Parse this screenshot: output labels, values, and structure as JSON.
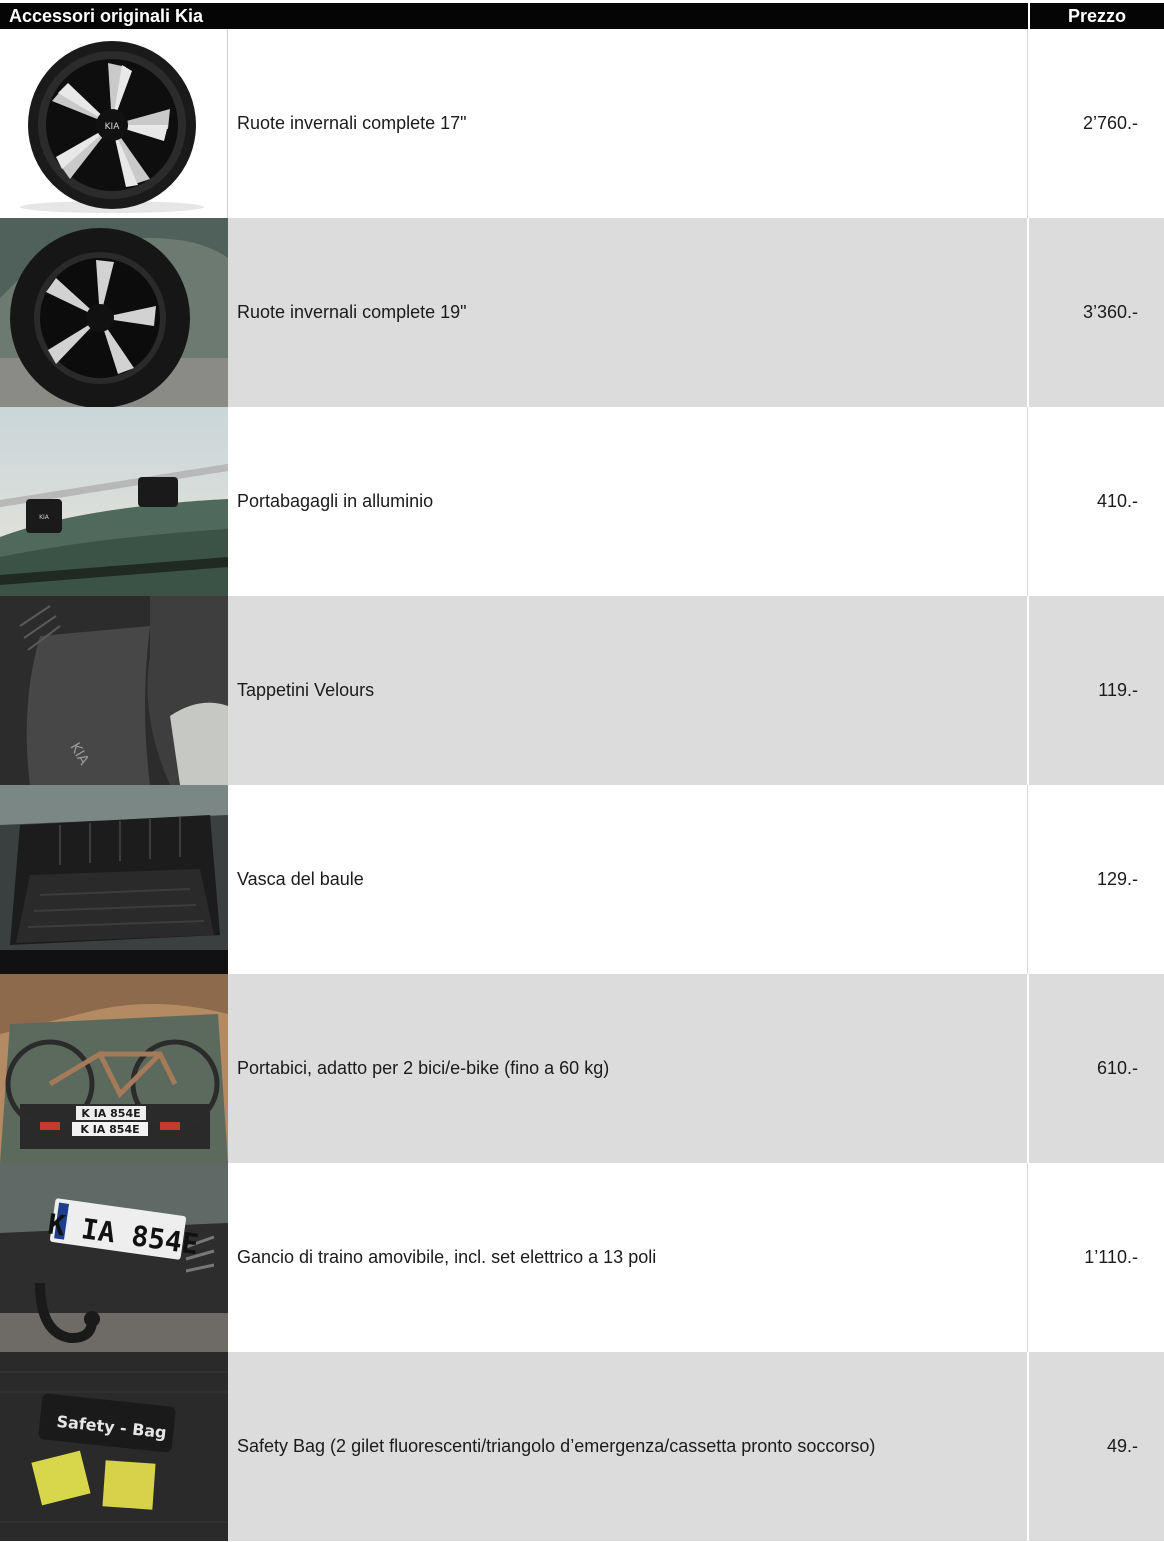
{
  "header": {
    "title": "Accessori originali Kia",
    "price": "Prezzo"
  },
  "rows": [
    {
      "desc": "Ruote invernali complete 17\"",
      "price": "2’760.-",
      "image": "alloy-wheel-17"
    },
    {
      "desc": "Ruote invernali complete 19\"",
      "price": "3’360.-",
      "image": "wheel-on-car-19"
    },
    {
      "desc": "Portabagagli in alluminio",
      "price": "410.-",
      "image": "roof-rack"
    },
    {
      "desc": "Tappetini Velours",
      "price": "119.-",
      "image": "floor-mat"
    },
    {
      "desc": "Vasca del baule",
      "price": "129.-",
      "image": "trunk-tray"
    },
    {
      "desc": "Portabici, adatto per 2 bici/e-bike (fino a 60 kg)",
      "price": "610.-",
      "image": "bike-carrier",
      "plate_a": "K IA 854E",
      "plate_b": "K IA 854E"
    },
    {
      "desc": "Gancio di traino amovibile, incl. set elettrico a 13 poli",
      "price": "1’110.-",
      "image": "tow-hook",
      "plate": "K IA 854E"
    },
    {
      "desc": "Safety Bag (2 gilet fluorescenti/triangolo d’emergenza/cassetta pronto soccorso)",
      "price": "49.-",
      "image": "safety-bag",
      "bag_label": "Safety - Bag"
    }
  ]
}
